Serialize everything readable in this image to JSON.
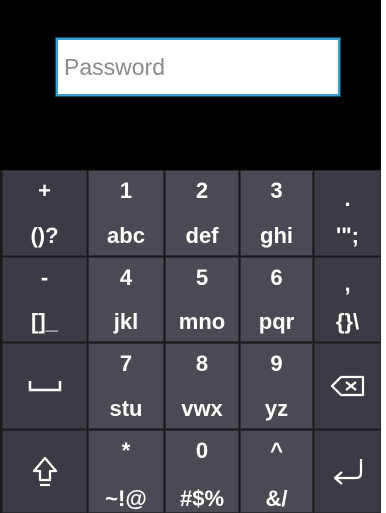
{
  "password_field": {
    "placeholder": "Password"
  },
  "keyboard": {
    "rows": [
      [
        {
          "top": "+",
          "bottom": "()?"
        },
        {
          "top": "1",
          "bottom": "abc"
        },
        {
          "top": "2",
          "bottom": "def"
        },
        {
          "top": "3",
          "bottom": "ghi"
        },
        {
          "top": ".",
          "bottom": "'\";"
        }
      ],
      [
        {
          "top": "-",
          "bottom": "[]_"
        },
        {
          "top": "4",
          "bottom": "jkl"
        },
        {
          "top": "5",
          "bottom": "mno"
        },
        {
          "top": "6",
          "bottom": "pqr"
        },
        {
          "top": ",",
          "bottom": "{}\\"
        }
      ],
      [
        {
          "icon": "space-icon"
        },
        {
          "top": "7",
          "bottom": "stu"
        },
        {
          "top": "8",
          "bottom": "vwx"
        },
        {
          "top": "9",
          "bottom": "yz"
        },
        {
          "icon": "backspace-icon"
        }
      ],
      [
        {
          "icon": "shift-icon"
        },
        {
          "top": "*",
          "bottom": "~!@"
        },
        {
          "top": "0",
          "bottom": "#$%"
        },
        {
          "top": "^",
          "bottom": "&/"
        },
        {
          "icon": "enter-icon"
        }
      ]
    ]
  }
}
